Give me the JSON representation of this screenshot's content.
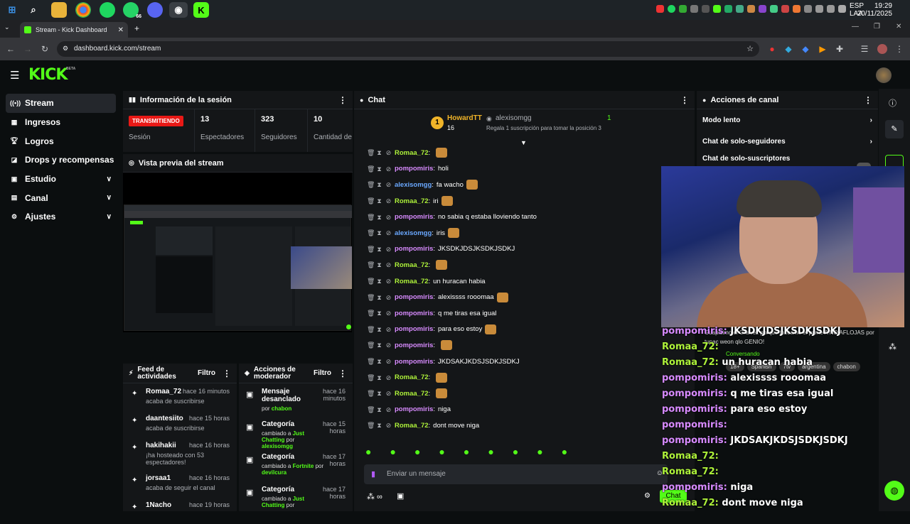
{
  "os": {
    "lang": "ESP",
    "region": "LAA",
    "time": "19:29",
    "date": "20/11/2025",
    "whatsapp_badge": "66"
  },
  "browser": {
    "tab_title": "Stream - Kick Dashboard",
    "url": "dashboard.kick.com/stream"
  },
  "kick": {
    "logo": "KICK",
    "beta": "BETA",
    "brand_color": "#53fc18"
  },
  "nav": [
    {
      "label": "Stream",
      "icon": "broadcast-icon",
      "active": true
    },
    {
      "label": "Ingresos",
      "icon": "revenue-icon"
    },
    {
      "label": "Logros",
      "icon": "trophy-icon"
    },
    {
      "label": "Drops y recompensas",
      "icon": "gift-icon"
    },
    {
      "label": "Estudio",
      "icon": "studio-icon",
      "expandable": true
    },
    {
      "label": "Canal",
      "icon": "channel-icon",
      "expandable": true
    },
    {
      "label": "Ajustes",
      "icon": "gear-icon",
      "expandable": true
    }
  ],
  "session": {
    "title": "Información de la sesión",
    "live_badge": "TRANSMITIENDO",
    "live_label": "Sesión",
    "stats": [
      {
        "value": "13",
        "label": "Espectadores"
      },
      {
        "value": "323",
        "label": "Seguidores"
      },
      {
        "value": "10",
        "label": "Cantidad de suscripciones"
      }
    ]
  },
  "preview": {
    "title": "Vista previa del stream"
  },
  "feed": {
    "title": "Feed de actividades",
    "filter": "Filtro",
    "items": [
      {
        "name": "Romaa_72",
        "time": "hace 16 minutos",
        "desc": "acaba de suscribirse",
        "icon": "star-icon"
      },
      {
        "name": "daantesiito",
        "time": "hace 15 horas",
        "desc": "acaba de suscribirse",
        "icon": "star-icon"
      },
      {
        "name": "hakihakii",
        "time": "hace 16 horas",
        "desc": "¡ha hosteado con 53 espectadores!",
        "icon": "host-icon"
      },
      {
        "name": "jorsaa1",
        "time": "hace 16 horas",
        "desc": "acaba de seguir el canal",
        "icon": "heart-icon"
      },
      {
        "name": "1Nacho",
        "time": "hace 19 horas",
        "desc": "",
        "icon": "follow-icon"
      }
    ]
  },
  "mod": {
    "title": "Acciones de moderador",
    "filter": "Filtro",
    "items": [
      {
        "title": "Mensaje desanclado",
        "time": "hace 16 minutos",
        "desc": "por",
        "by": "chabon"
      },
      {
        "title": "Categoría",
        "time": "hace 15 horas",
        "desc": "cambiado a",
        "cat": "Just Chatting",
        "desc2": "por",
        "by": "alexisomgg"
      },
      {
        "title": "Categoría",
        "time": "hace 17 horas",
        "desc": "cambiado a",
        "cat": "Fortnite",
        "desc2": "por",
        "by": "devilcura"
      },
      {
        "title": "Categoría",
        "time": "hace 17 horas",
        "desc": "cambiado a",
        "cat": "Just Chatting",
        "desc2": "por",
        "by": ""
      }
    ]
  },
  "chat": {
    "title": "Chat",
    "top_gifter": {
      "name": "HowardTT",
      "count": "16",
      "rank": "1"
    },
    "top2": {
      "name": "alexisomgg",
      "count": "1"
    },
    "gift_prompt": "Regala 1 suscripción para tomar la posición 3",
    "input_placeholder": "Enviar un mensaje",
    "send_label": "Chat",
    "messages": [
      {
        "user": "Romaa_72",
        "color": "#aef23a",
        "text": "",
        "emote": true
      },
      {
        "user": "pompomiris",
        "color": "#d88bff",
        "text": "holi"
      },
      {
        "user": "alexisomgg",
        "color": "#6aa8ff",
        "text": "fa wacho",
        "emote": true
      },
      {
        "user": "Romaa_72",
        "color": "#aef23a",
        "text": "iri",
        "emote": true
      },
      {
        "user": "pompomiris",
        "color": "#d88bff",
        "text": "no sabia q estaba lloviendo tanto"
      },
      {
        "user": "alexisomgg",
        "color": "#6aa8ff",
        "text": "iris",
        "emote": true
      },
      {
        "user": "pompomiris",
        "color": "#d88bff",
        "text": "JKSDKJDSJKSDKJSDKJ"
      },
      {
        "user": "Romaa_72",
        "color": "#aef23a",
        "text": "",
        "emote": true
      },
      {
        "user": "Romaa_72",
        "color": "#aef23a",
        "text": "un huracan habia"
      },
      {
        "user": "pompomiris",
        "color": "#d88bff",
        "text": "alexissss rooomaa",
        "emote": true
      },
      {
        "user": "pompomiris",
        "color": "#d88bff",
        "text": "q me tiras esa igual"
      },
      {
        "user": "pompomiris",
        "color": "#d88bff",
        "text": "para eso estoy",
        "emote": true
      },
      {
        "user": "pompomiris",
        "color": "#d88bff",
        "text": "",
        "emote": true
      },
      {
        "user": "pompomiris",
        "color": "#d88bff",
        "text": "JKDSAKJKDSJSDKJSDKJ"
      },
      {
        "user": "Romaa_72",
        "color": "#aef23a",
        "text": "",
        "emote": true
      },
      {
        "user": "Romaa_72",
        "color": "#aef23a",
        "text": "",
        "emote": true
      },
      {
        "user": "pompomiris",
        "color": "#d88bff",
        "text": "niga"
      },
      {
        "user": "Romaa_72",
        "color": "#aef23a",
        "text": "dont move niga"
      }
    ]
  },
  "actions": {
    "title": "Acciones de canal",
    "items": [
      {
        "label": "Modo lento"
      },
      {
        "label": "Chat de solo-seguidores"
      },
      {
        "label": "Chat de solo-suscriptores"
      }
    ]
  },
  "overlay": {
    "partial_top": "JKSDKJDSJKSDKJSDKJ",
    "partial_top2": "Guapisimo el Chavez porque tozeame el prime A NO AFLOJAS por tupac weon qlo GENIO!",
    "conversando": "Conversando",
    "tags": [
      "18+",
      "Spanish",
      "7tv",
      "argentina",
      "chabon"
    ],
    "lines": [
      {
        "user": "pompomiris:",
        "color": "#d88bff",
        "text": "JKSDKJDSJKSDKJSDKJ"
      },
      {
        "user": "Romaa_72:",
        "color": "#aef23a",
        "text": ""
      },
      {
        "user": "Romaa_72:",
        "color": "#aef23a",
        "text": "un huracan habia"
      },
      {
        "user": "pompomiris:",
        "color": "#d88bff",
        "text": "alexissss rooomaa"
      },
      {
        "user": "pompomiris:",
        "color": "#d88bff",
        "text": "q me tiras esa igual"
      },
      {
        "user": "pompomiris:",
        "color": "#d88bff",
        "text": "para eso estoy"
      },
      {
        "user": "pompomiris:",
        "color": "#d88bff",
        "text": ""
      },
      {
        "user": "pompomiris:",
        "color": "#d88bff",
        "text": "JKDSAKJKDSJSDKJSDKJ"
      },
      {
        "user": "Romaa_72:",
        "color": "#aef23a",
        "text": ""
      },
      {
        "user": "Romaa_72:",
        "color": "#aef23a",
        "text": ""
      },
      {
        "user": "pompomiris:",
        "color": "#d88bff",
        "text": "niga"
      },
      {
        "user": "Romaa_72:",
        "color": "#aef23a",
        "text": "dont move niga"
      }
    ]
  }
}
